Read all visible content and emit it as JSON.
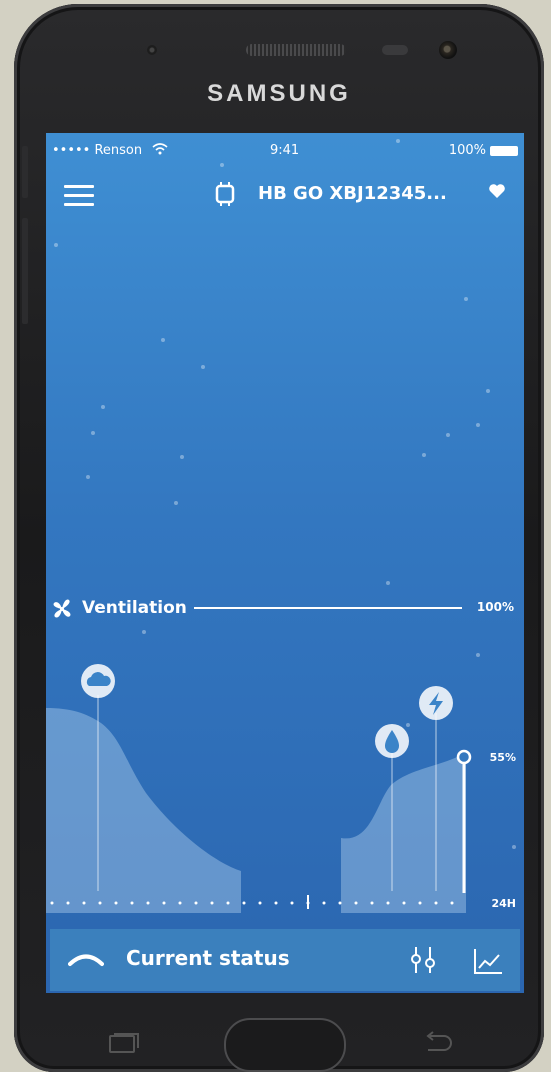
{
  "device": {
    "brand": "SAMSUNG"
  },
  "status_bar": {
    "carrier": "••••• Renson",
    "time": "9:41",
    "battery": "100%"
  },
  "header": {
    "device_name": "HB GO XBJ12345..."
  },
  "ventilation": {
    "label": "Ventilation",
    "max_label": "100%",
    "level_label": "55%",
    "time_label": "24H",
    "current_level_percent": 55
  },
  "bottom_bar": {
    "title": "Current status"
  },
  "icons": [
    "menu-icon",
    "device-icon",
    "heart-icon",
    "fan-icon",
    "cloud-icon",
    "drop-icon",
    "bolt-icon",
    "chevron-up-icon",
    "sliders-icon",
    "graph-icon"
  ],
  "colors": {
    "screen_top": "#3f8fd3",
    "screen_bottom": "#2b66b0",
    "accent": "#ffffff"
  }
}
